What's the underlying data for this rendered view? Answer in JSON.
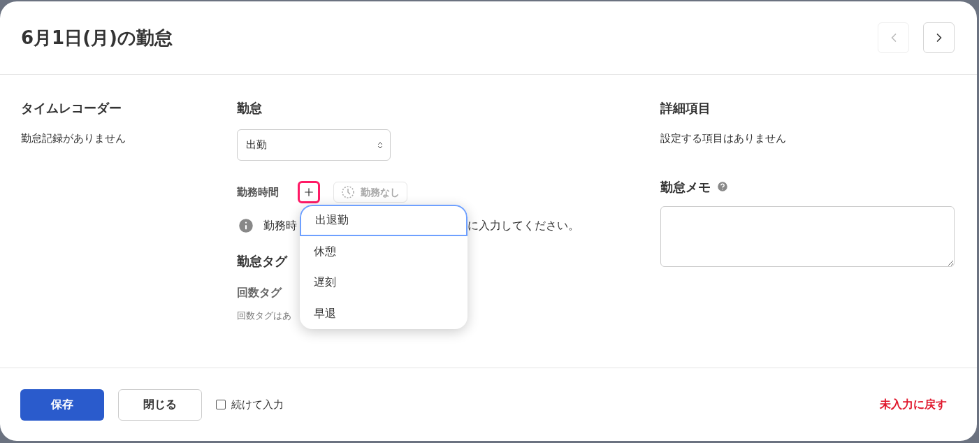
{
  "title": "6月1日(月)の勤怠",
  "nav": [
    {
      "kind": "prev",
      "disabled": true
    },
    {
      "kind": "next",
      "disabled": false
    }
  ],
  "time_recorder": {
    "heading": "タイムレコーダー",
    "message": "勤怠記録がありません"
  },
  "attendance": {
    "heading": "勤怠",
    "select": {
      "value": "出勤"
    },
    "work_time": {
      "label": "勤務時間",
      "no_work_button": "勤務なし"
    },
    "info": {
      "before": "勤務時",
      "after": "に入力してください。"
    },
    "tags": {
      "heading": "勤怠タグ",
      "count_tag": {
        "label": "回数タグ",
        "note": "回数タグはあ"
      }
    }
  },
  "menu": {
    "items": [
      {
        "label": "出退勤",
        "selected": true
      },
      {
        "label": "休憩",
        "selected": false
      },
      {
        "label": "遅刻",
        "selected": false
      },
      {
        "label": "早退",
        "selected": false
      }
    ]
  },
  "details": {
    "heading": "詳細項目",
    "message": "設定する項目はありません"
  },
  "memo": {
    "heading": "勤怠メモ"
  },
  "footer": {
    "save": "保存",
    "close": "閉じる",
    "continue": {
      "label": "続けて入力",
      "checked": false
    },
    "reset": "未入力に戻す"
  }
}
